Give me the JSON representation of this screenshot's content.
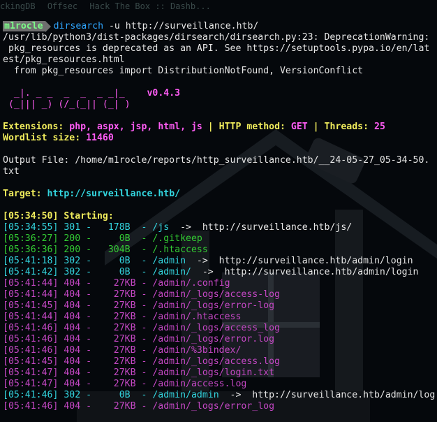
{
  "tabs": [
    "ckingDB",
    "Offsec",
    "Hack The Box :: Dashb..."
  ],
  "prompt": {
    "dir": "[~]",
    "user": "m1rocle",
    "command": "dirsearch",
    "args": " -u http://surveillance.htb/"
  },
  "warning": [
    "/usr/lib/python3/dist-packages/dirsearch/dirsearch.py:23: DeprecationWarning:",
    " pkg_resources is deprecated as an API. See https://setuptools.pypa.io/en/lat",
    "est/pkg_resources.html",
    "  from pkg_resources import DistributionNotFound, VersionConflict"
  ],
  "banner": {
    "line1": "  _|. _ _  _  _  _ _|_    ",
    "line2": " (_||| _) (/_(_|| (_| )   ",
    "version": "v0.4.3"
  },
  "config": {
    "ext_label": "Extensions: ",
    "ext_value": "php, aspx, jsp, html, js",
    "sep": " | ",
    "method_label": "HTTP method: ",
    "method_value": "GET",
    "threads_label": "Threads: ",
    "threads_value": "25",
    "wordlist_label": "Wordlist size: ",
    "wordlist_value": "11460"
  },
  "output_file": [
    "Output File: /home/m1rocle/reports/http_surveillance.htb/__24-05-27_05-34-50.",
    "txt"
  ],
  "target": {
    "label": "Target: ",
    "url": "http://surveillance.htb/"
  },
  "starting": {
    "time": "[05:34:50]",
    "label": " Starting: "
  },
  "results": [
    {
      "time": "[05:34:55]",
      "rest": " 301 -   178B  - /js",
      "arrow": "  ->  ",
      "redirect": "http://surveillance.htb/js/",
      "color": "cy"
    },
    {
      "time": "[05:36:27]",
      "rest": " 200 -     0B  - /.gitkeep",
      "arrow": "",
      "redirect": "",
      "color": "grn"
    },
    {
      "time": "[05:36:36]",
      "rest": " 200 -   304B  - /.htaccess",
      "arrow": "",
      "redirect": "",
      "color": "grn"
    },
    {
      "time": "[05:41:18]",
      "rest": " 302 -     0B  - /admin",
      "arrow": "  ->  ",
      "redirect": "http://surveillance.htb/admin/login",
      "color": "cy"
    },
    {
      "time": "[05:41:42]",
      "rest": " 302 -     0B  - /admin/",
      "arrow": "  ->  ",
      "redirect": "http://surveillance.htb/admin/login",
      "color": "cy"
    },
    {
      "time": "[05:41:44]",
      "rest": " 404 -    27KB - /admin/.config",
      "arrow": "",
      "redirect": "",
      "color": "pur"
    },
    {
      "time": "[05:41:44]",
      "rest": " 404 -    27KB - /admin/_logs/access-log",
      "arrow": "",
      "redirect": "",
      "color": "pur"
    },
    {
      "time": "[05:41:45]",
      "rest": " 404 -    27KB - /admin/_logs/error-log",
      "arrow": "",
      "redirect": "",
      "color": "pur"
    },
    {
      "time": "[05:41:44]",
      "rest": " 404 -    27KB - /admin/.htaccess",
      "arrow": "",
      "redirect": "",
      "color": "pur"
    },
    {
      "time": "[05:41:46]",
      "rest": " 404 -    27KB - /admin/_logs/access_log",
      "arrow": "",
      "redirect": "",
      "color": "pur"
    },
    {
      "time": "[05:41:46]",
      "rest": " 404 -    27KB - /admin/_logs/error.log",
      "arrow": "",
      "redirect": "",
      "color": "pur"
    },
    {
      "time": "[05:41:46]",
      "rest": " 404 -    27KB - /admin/%3bindex/",
      "arrow": "",
      "redirect": "",
      "color": "pur"
    },
    {
      "time": "[05:41:45]",
      "rest": " 404 -    27KB - /admin/_logs/access.log",
      "arrow": "",
      "redirect": "",
      "color": "pur"
    },
    {
      "time": "[05:41:47]",
      "rest": " 404 -    27KB - /admin/_logs/login.txt",
      "arrow": "",
      "redirect": "",
      "color": "pur"
    },
    {
      "time": "[05:41:47]",
      "rest": " 404 -    27KB - /admin/access.log",
      "arrow": "",
      "redirect": "",
      "color": "pur"
    },
    {
      "time": "[05:41:46]",
      "rest": " 302 -     0B  - /admin/admin",
      "arrow": "  ->  ",
      "redirect": "http://surveillance.htb/admin/log",
      "color": "cy"
    },
    {
      "time": "[05:41:46]",
      "rest": " 404 -    27KB - /admin/_logs/error_log",
      "arrow": "",
      "redirect": "",
      "color": "pur"
    }
  ]
}
